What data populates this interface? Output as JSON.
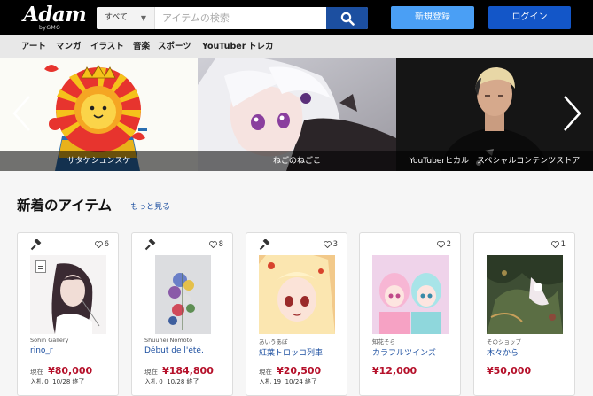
{
  "header": {
    "logo": "Adam",
    "logo_sub": "byGMO",
    "search_category": "すべて",
    "search_placeholder": "アイテムの検索",
    "register_label": "新規登録",
    "login_label": "ログイン"
  },
  "nav": {
    "items": [
      "アート",
      "マンガ",
      "イラスト",
      "音楽",
      "スポーツ",
      "YouTuber",
      "トレカ"
    ]
  },
  "carousel": {
    "slides": [
      {
        "caption": "サタケシュンスケ"
      },
      {
        "caption": "ねごのねごこ"
      },
      {
        "caption": "YouTuberヒカル　スペシャルコンテンツストア"
      }
    ]
  },
  "section": {
    "title": "新着のアイテム",
    "more": "もっと見る"
  },
  "items": [
    {
      "likes": "6",
      "seller": "Sohin Gallery",
      "title": "rino_r",
      "price_label": "現在",
      "price": "¥80,000",
      "bids": "入札 0",
      "end": "10/28 終了"
    },
    {
      "likes": "8",
      "seller": "Shuuhei Nomoto",
      "title": "Début de l'été.",
      "price_label": "現在",
      "price": "¥184,800",
      "bids": "入札 0",
      "end": "10/28 終了"
    },
    {
      "likes": "3",
      "seller": "あいうあぼ",
      "title": "紅葉トロッコ列車",
      "price_label": "現在",
      "price": "¥20,500",
      "bids": "入札 19",
      "end": "10/24 終了"
    },
    {
      "likes": "2",
      "seller": "知花そら",
      "title": "カラフルツインズ",
      "price_label": "",
      "price": "¥12,000",
      "bids": "",
      "end": ""
    },
    {
      "likes": "1",
      "seller": "そのショップ",
      "title": "木々から",
      "price_label": "",
      "price": "¥50,000",
      "bids": "",
      "end": ""
    }
  ],
  "colors": {
    "header_bg": "#000000",
    "nav_bg": "#e8e8e8",
    "primary_blue": "#1356c8",
    "light_blue": "#4a9ff5",
    "price_red": "#b5102a",
    "link_blue": "#1c4fa0"
  }
}
